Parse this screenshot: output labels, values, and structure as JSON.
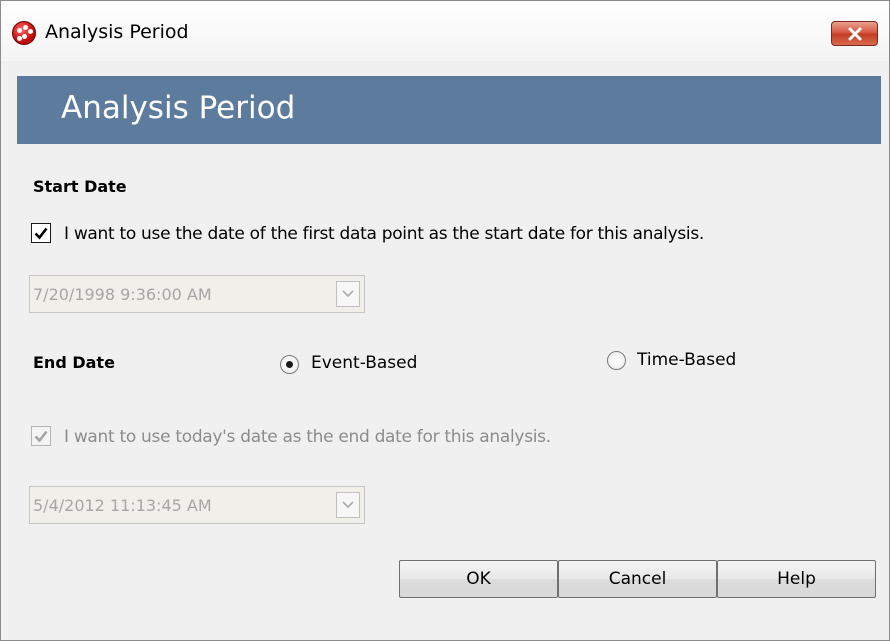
{
  "window": {
    "title": "Analysis Period",
    "close_symbol": "×"
  },
  "header": {
    "title": "Analysis Period"
  },
  "start_date": {
    "section_label": "Start Date",
    "use_first_point": {
      "checked": true,
      "label": "I want to use the date of the first data point as the start date for this analysis."
    },
    "date_value": "7/20/1998 9:36:00 AM"
  },
  "end_date": {
    "section_label": "End Date",
    "options": [
      {
        "label": "Event-Based",
        "selected": true
      },
      {
        "label": "Time-Based",
        "selected": false
      }
    ],
    "use_today": {
      "checked": true,
      "disabled": true,
      "label": "I want to use today's date as the end date for this analysis."
    },
    "date_value": "5/4/2012 11:13:45 AM"
  },
  "buttons": {
    "ok": "OK",
    "cancel": "Cancel",
    "help": "Help"
  },
  "icons": {
    "app": "app-icon",
    "close": "close-icon",
    "checkmark": "checkmark-icon",
    "dropdown": "chevron-down-icon"
  },
  "colors": {
    "header_bg": "#5d7b9c",
    "header_text": "#ffffff",
    "close_button": "#c9442d"
  }
}
